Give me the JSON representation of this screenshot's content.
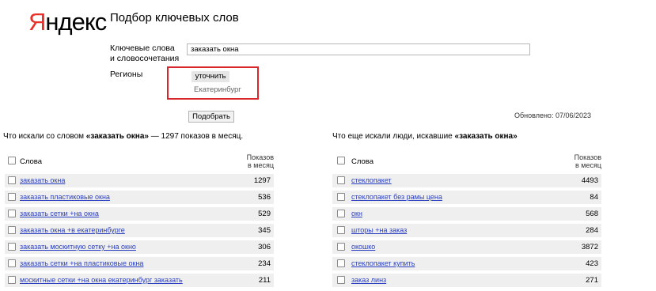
{
  "logo": {
    "first": "Я",
    "rest": "ндекс"
  },
  "page_title": "Подбор ключевых слов",
  "form": {
    "keywords_label_line1": "Ключевые слова",
    "keywords_label_line2": "и словосочетания",
    "keywords_value": "заказать окна",
    "regions_label": "Регионы",
    "refine_button": "уточнить",
    "region_value": "Екатеринбург",
    "pick_button": "Подобрать"
  },
  "updated": "Обновлено: 07/06/2023",
  "left_section": {
    "title_prefix": "Что искали со словом ",
    "title_bold": "«заказать окна»",
    "title_suffix": " — 1297 показов в месяц.",
    "col_words": "Слова",
    "col_count_line1": "Показов",
    "col_count_line2": "в месяц",
    "rows": [
      {
        "text": "заказать окна",
        "count": "1297"
      },
      {
        "text": "заказать пластиковые окна",
        "count": "536"
      },
      {
        "text": "заказать сетки +на окна",
        "count": "529"
      },
      {
        "text": "заказать окна +в екатеринбурге",
        "count": "345"
      },
      {
        "text": "заказать москитную сетку +на окно",
        "count": "306"
      },
      {
        "text": "заказать сетки +на пластиковые окна",
        "count": "234"
      },
      {
        "text": "москитные сетки +на окна екатеринбург заказать",
        "count": "211"
      }
    ]
  },
  "right_section": {
    "title_prefix": "Что еще искали люди, искавшие ",
    "title_bold": "«заказать окна»",
    "col_words": "Слова",
    "col_count_line1": "Показов",
    "col_count_line2": "в месяц",
    "rows": [
      {
        "text": "стеклопакет",
        "count": "4493"
      },
      {
        "text": "стеклопакет без рамы цена",
        "count": "84"
      },
      {
        "text": "окн",
        "count": "568"
      },
      {
        "text": "шторы +на заказ",
        "count": "284"
      },
      {
        "text": "окошко",
        "count": "3872"
      },
      {
        "text": "стеклопакет купить",
        "count": "423"
      },
      {
        "text": "заказ линз",
        "count": "271"
      }
    ]
  },
  "colors": {
    "logo_red": "#e8312a",
    "link": "#2a3fbf",
    "highlight": "#d9262c",
    "row_bg": "#efefef"
  }
}
